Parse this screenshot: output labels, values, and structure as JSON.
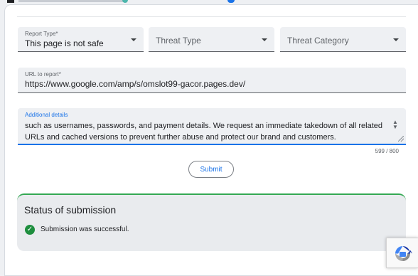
{
  "form": {
    "report_type": {
      "label": "Report Type*",
      "value": "This page is not safe"
    },
    "threat_type": {
      "placeholder": "Threat Type"
    },
    "threat_category": {
      "placeholder": "Threat Category"
    },
    "url": {
      "label": "URL to report*",
      "value": "https://www.google.com/amp/s/omslot99-gacor.pages.dev/"
    },
    "details": {
      "label": "Additional details",
      "value": "such as usernames, passwords, and payment details. We request an immediate takedown of all related URLs and cached versions to prevent further abuse and protect our brand and customers.",
      "counter": "599 / 800"
    },
    "submit_label": "Submit"
  },
  "status": {
    "title": "Status of submission",
    "message": "Submission was successful."
  },
  "icons": {
    "dropdown": "caret-down-icon",
    "success": "check-circle-icon",
    "captcha": "recaptcha-icon"
  },
  "colors": {
    "accent": "#1a73e8",
    "success": "#34a853"
  }
}
